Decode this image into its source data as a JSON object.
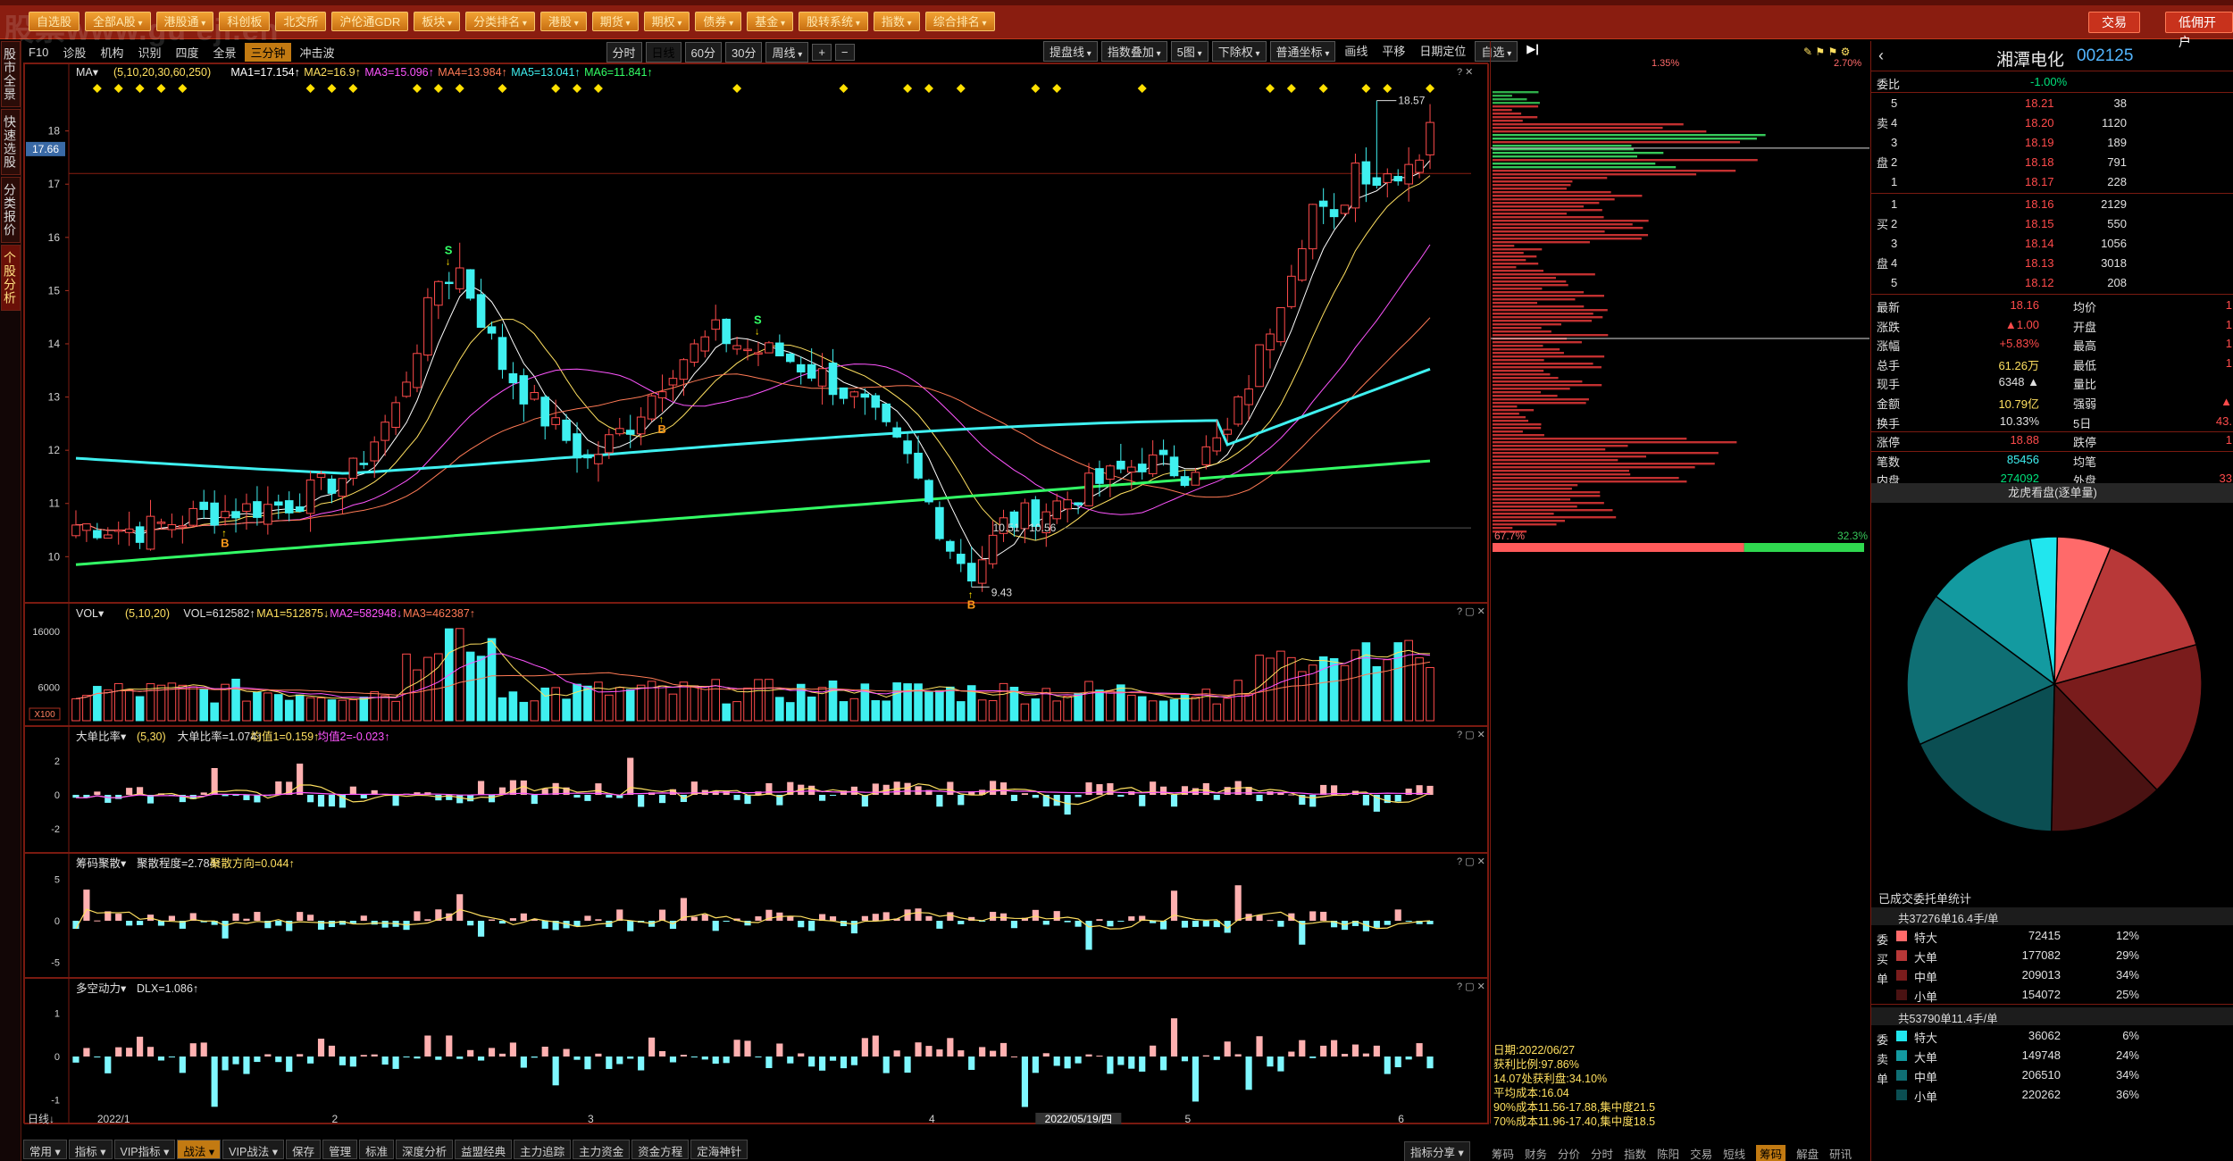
{
  "topbar": {
    "watermark": "股票www.gu eji.en",
    "nav": [
      {
        "label": "自选股",
        "dd": false
      },
      {
        "label": "全部A股",
        "dd": true
      },
      {
        "label": "港股通",
        "dd": true
      },
      {
        "label": "科创板",
        "dd": false
      },
      {
        "label": "北交所",
        "dd": false
      },
      {
        "label": "沪伦通GDR",
        "dd": false
      },
      {
        "label": "板块",
        "dd": true
      },
      {
        "label": "分类排名",
        "dd": true
      },
      {
        "label": "港股",
        "dd": true
      },
      {
        "label": "期货",
        "dd": true
      },
      {
        "label": "期权",
        "dd": true
      },
      {
        "label": "债券",
        "dd": true
      },
      {
        "label": "基金",
        "dd": true
      },
      {
        "label": "股转系统",
        "dd": true
      },
      {
        "label": "指数",
        "dd": true
      },
      {
        "label": "综合排名",
        "dd": true
      }
    ],
    "trade_label": "交易",
    "open_label": "低佣开户"
  },
  "left_tabs": [
    {
      "label": "股市全景",
      "active": false
    },
    {
      "label": "快速选股",
      "active": false
    },
    {
      "label": "分类报价",
      "active": false
    },
    {
      "label": "个股分析",
      "active": true
    }
  ],
  "toolbar": {
    "left": [
      {
        "label": "F10",
        "on": false
      },
      {
        "label": "诊股",
        "on": false
      },
      {
        "label": "机构",
        "on": false
      },
      {
        "label": "识别",
        "on": false
      },
      {
        "label": "四度",
        "on": false
      },
      {
        "label": "全景",
        "on": false
      },
      {
        "label": "三分钟",
        "on": true
      },
      {
        "label": "冲击波",
        "on": false
      }
    ],
    "period": [
      {
        "label": "分时",
        "on": false
      },
      {
        "label": "日线",
        "on": true
      },
      {
        "label": "60分",
        "on": false
      },
      {
        "label": "30分",
        "on": false
      },
      {
        "label": "周线",
        "on": false,
        "dd": true
      }
    ],
    "zoom": [
      "+",
      "−"
    ],
    "right": [
      {
        "label": "提盘线",
        "dd": true
      },
      {
        "label": "指数叠加",
        "dd": true
      },
      {
        "label": "5图",
        "dd": true
      },
      {
        "label": "下除权",
        "dd": true
      },
      {
        "label": "普通坐标",
        "dd": true
      },
      {
        "label": "画线",
        "dd": false
      },
      {
        "label": "平移",
        "dd": false
      },
      {
        "label": "日期定位",
        "dd": false
      },
      {
        "label": "自选",
        "dd": true
      }
    ]
  },
  "main_chart": {
    "indicator_name": "MA",
    "params": "(5,10,20,30,60,250)",
    "ma": [
      {
        "label": "MA1=17.154",
        "arrow": "↑",
        "color": "#ffffff"
      },
      {
        "label": "MA2=16.9",
        "arrow": "↑",
        "color": "#ffe060"
      },
      {
        "label": "MA3=15.096",
        "arrow": "↑",
        "color": "#ff55ff"
      },
      {
        "label": "MA4=13.984",
        "arrow": "↑",
        "color": "#ff7a55"
      },
      {
        "label": "MA5=13.041",
        "arrow": "↑",
        "color": "#3ff0f0"
      },
      {
        "label": "MA6=11.841",
        "arrow": "↑",
        "color": "#33ff66"
      }
    ],
    "price_ticks": [
      "18",
      "17",
      "16",
      "15",
      "14",
      "13",
      "12",
      "11",
      "10"
    ],
    "current_price_tag": "17.66",
    "high_label": "18.57",
    "low_label": "9.43",
    "range_label": "10.51 - 10.56",
    "buy_marks": [
      "B",
      "B",
      "B"
    ],
    "sell_marks": [
      "S",
      "S"
    ],
    "date_ticks": [
      "2022/1",
      "2",
      "3",
      "4",
      "5",
      "6"
    ],
    "cursor_date": "2022/05/19/四",
    "period_label": "日线"
  },
  "vol_panel": {
    "name": "VOL",
    "params": "(5,10,20)",
    "values": [
      {
        "label": "VOL=612582",
        "arrow": "↑",
        "color": "#e0e0e0"
      },
      {
        "label": "MA1=512875",
        "arrow": "↓",
        "color": "#ffe060"
      },
      {
        "label": "MA2=582948",
        "arrow": "↓",
        "color": "#ff55ff"
      },
      {
        "label": "MA3=462387",
        "arrow": "↑",
        "color": "#ff7a55"
      }
    ],
    "ticks": [
      "16000",
      "6000"
    ],
    "unit": "X100"
  },
  "big_order_panel": {
    "name": "大单比率",
    "params": "(5,30)",
    "values": [
      {
        "label": "大单比率=1.074",
        "arrow": "↑",
        "color": "#e0e0e0"
      },
      {
        "label": "均值1=0.159",
        "arrow": "↑",
        "color": "#ffe060"
      },
      {
        "label": "均值2=-0.023",
        "arrow": "↑",
        "color": "#ff55ff"
      }
    ],
    "ticks": [
      "2",
      "0",
      "-2"
    ]
  },
  "chip_panel": {
    "name": "筹码聚散",
    "values": [
      {
        "label": "聚散程度=2.784",
        "arrow": "↑",
        "color": "#e0e0e0"
      },
      {
        "label": "聚散方向=0.044",
        "arrow": "↑",
        "color": "#ffe060"
      }
    ],
    "ticks": [
      "5",
      "0",
      "-5"
    ]
  },
  "power_panel": {
    "name": "多空动力",
    "values": [
      {
        "label": "DLX=1.086",
        "arrow": "↑",
        "color": "#e0e0e0"
      }
    ],
    "ticks": [
      "1",
      "0",
      "-1"
    ]
  },
  "bottom_tabs": [
    {
      "label": "常用",
      "dd": true
    },
    {
      "label": "指标",
      "dd": true
    },
    {
      "label": "VIP指标",
      "dd": true
    },
    {
      "label": "战法",
      "dd": true,
      "on": true
    },
    {
      "label": "VIP战法",
      "dd": true
    },
    {
      "label": "保存",
      "dd": false
    },
    {
      "label": "管理",
      "dd": false
    },
    {
      "label": "标准",
      "dd": false
    },
    {
      "label": "深度分析",
      "dd": false
    },
    {
      "label": "益盟经典",
      "dd": false
    },
    {
      "label": "主力追踪",
      "dd": false
    },
    {
      "label": "主力资金",
      "dd": false
    },
    {
      "label": "资金方程",
      "dd": false
    },
    {
      "label": "定海神针",
      "dd": false
    }
  ],
  "bottom_right_tab": "指标分享",
  "profile": {
    "top_left": "1.35%",
    "top_right": "2.70%",
    "left_pct": "67.7%",
    "right_pct": "32.3%",
    "info": [
      "日期:2022/06/27",
      "获利比例:97.86%",
      "14.07处获利盘:34.10%",
      "平均成本:16.04",
      "90%成本11.56-17.88,集中度21.5",
      "70%成本11.96-17.40,集中度18.5"
    ],
    "tabs": [
      "筹码",
      "财务",
      "分价",
      "分时",
      "指数",
      "陈阳",
      "交易",
      "短线",
      "筹码",
      "解盘",
      "研讯"
    ],
    "active_tab": 8
  },
  "quote": {
    "name": "湘潭电化",
    "code": "002125",
    "weibi_label": "委比",
    "weibi_value": "-1.00%",
    "asks": [
      {
        "lvl": "5",
        "price": "18.21",
        "vol": "38"
      },
      {
        "lvl": "4",
        "price": "18.20",
        "vol": "1120"
      },
      {
        "lvl": "3",
        "price": "18.19",
        "vol": "189"
      },
      {
        "lvl": "2",
        "price": "18.18",
        "vol": "791"
      },
      {
        "lvl": "1",
        "price": "18.17",
        "vol": "228"
      }
    ],
    "bids": [
      {
        "lvl": "1",
        "price": "18.16",
        "vol": "2129"
      },
      {
        "lvl": "2",
        "price": "18.15",
        "vol": "550"
      },
      {
        "lvl": "3",
        "price": "18.14",
        "vol": "1056"
      },
      {
        "lvl": "4",
        "price": "18.13",
        "vol": "3018"
      },
      {
        "lvl": "5",
        "price": "18.12",
        "vol": "208"
      }
    ],
    "ask_side": [
      "卖",
      "盘"
    ],
    "bid_side": [
      "买",
      "盘"
    ],
    "stats": [
      {
        "k1": "最新",
        "v1": "18.16",
        "c1": "red",
        "k2": "均价",
        "v2": "1"
      },
      {
        "k1": "涨跌",
        "v1": "▲1.00",
        "c1": "red",
        "k2": "开盘",
        "v2": "1"
      },
      {
        "k1": "涨幅",
        "v1": "+5.83%",
        "c1": "red",
        "k2": "最高",
        "v2": "1"
      },
      {
        "k1": "总手",
        "v1": "61.26万",
        "c1": "yellow",
        "k2": "最低",
        "v2": "1"
      },
      {
        "k1": "现手",
        "v1": "6348 ▲",
        "c1": "white",
        "k2": "量比",
        "v2": ""
      },
      {
        "k1": "金额",
        "v1": "10.79亿",
        "c1": "yellow",
        "k2": "强弱",
        "v2": "▲"
      },
      {
        "k1": "换手",
        "v1": "10.33%",
        "c1": "white",
        "k2": "5日",
        "v2": "43."
      },
      {
        "k1": "涨停",
        "v1": "18.88",
        "c1": "red",
        "k2": "跌停",
        "v2": "1"
      },
      {
        "k1": "笔数",
        "v1": "85456",
        "c1": "cyan",
        "k2": "均笔",
        "v2": ""
      },
      {
        "k1": "内盘",
        "v1": "274092",
        "c1": "green",
        "k2": "外盘",
        "v2": "33"
      }
    ],
    "dragon_title": "龙虎看盘(逐单量)",
    "pie": [
      {
        "label": "委买特大",
        "value": 72415,
        "color": "#ff6a6a"
      },
      {
        "label": "委买大单",
        "value": 177082,
        "color": "#b83838"
      },
      {
        "label": "委买中单",
        "value": 209013,
        "color": "#7a1c1c"
      },
      {
        "label": "委买小单",
        "value": 154072,
        "color": "#4a1212"
      },
      {
        "label": "委卖小单",
        "value": 220262,
        "color": "#0b4e52"
      },
      {
        "label": "委卖中单",
        "value": 206510,
        "color": "#0f6f74"
      },
      {
        "label": "委卖大单",
        "value": 149748,
        "color": "#139aa0"
      },
      {
        "label": "委卖特大",
        "value": 36062,
        "color": "#21e6ee"
      }
    ],
    "stat_title": "已成交委托单统计",
    "buy_summary": "共37276单16.4手/单",
    "sell_summary": "共53790单11.4手/单",
    "buy_side": [
      "委",
      "买",
      "单"
    ],
    "sell_side": [
      "委",
      "卖",
      "单"
    ],
    "buy_rows": [
      {
        "label": "特大",
        "vol": "72415",
        "pct": "12%",
        "color": "#ff6a6a"
      },
      {
        "label": "大单",
        "vol": "177082",
        "pct": "29%",
        "color": "#b83838"
      },
      {
        "label": "中单",
        "vol": "209013",
        "pct": "34%",
        "color": "#7a1c1c"
      },
      {
        "label": "小单",
        "vol": "154072",
        "pct": "25%",
        "color": "#4a1212"
      }
    ],
    "sell_rows": [
      {
        "label": "特大",
        "vol": "36062",
        "pct": "6%",
        "color": "#21e6ee"
      },
      {
        "label": "大单",
        "vol": "149748",
        "pct": "24%",
        "color": "#139aa0"
      },
      {
        "label": "中单",
        "vol": "206510",
        "pct": "34%",
        "color": "#0f6f74"
      },
      {
        "label": "小单",
        "vol": "220262",
        "pct": "36%",
        "color": "#0b4e52"
      }
    ]
  },
  "colors": {
    "up": "#ff4b4b",
    "down": "#3ff0f0",
    "grid": "#7a1a10",
    "accent": "#c27a12"
  }
}
